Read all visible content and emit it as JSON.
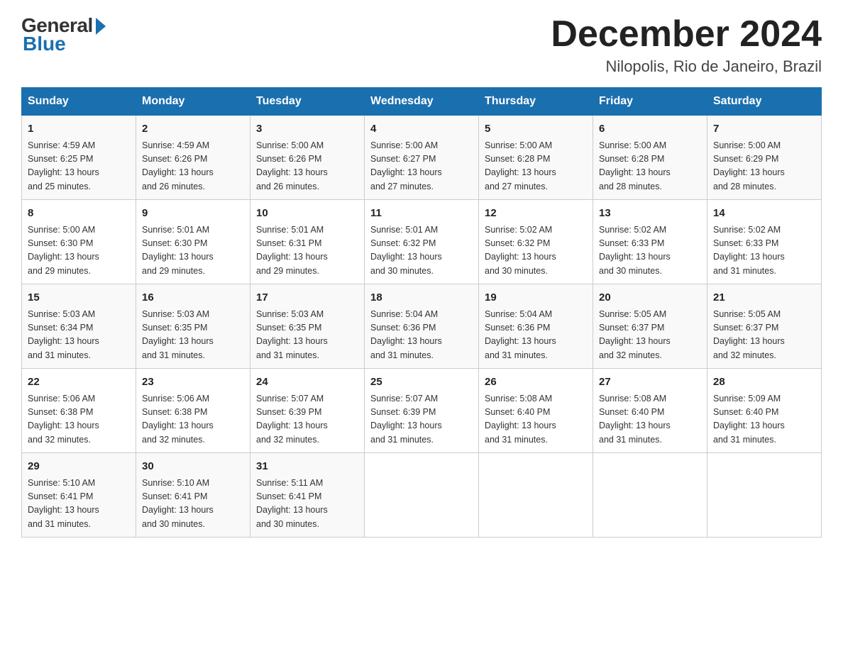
{
  "logo": {
    "general": "General",
    "blue": "Blue"
  },
  "title": "December 2024",
  "location": "Nilopolis, Rio de Janeiro, Brazil",
  "days_of_week": [
    "Sunday",
    "Monday",
    "Tuesday",
    "Wednesday",
    "Thursday",
    "Friday",
    "Saturday"
  ],
  "weeks": [
    [
      {
        "num": "1",
        "sunrise": "4:59 AM",
        "sunset": "6:25 PM",
        "daylight": "13 hours and 25 minutes."
      },
      {
        "num": "2",
        "sunrise": "4:59 AM",
        "sunset": "6:26 PM",
        "daylight": "13 hours and 26 minutes."
      },
      {
        "num": "3",
        "sunrise": "5:00 AM",
        "sunset": "6:26 PM",
        "daylight": "13 hours and 26 minutes."
      },
      {
        "num": "4",
        "sunrise": "5:00 AM",
        "sunset": "6:27 PM",
        "daylight": "13 hours and 27 minutes."
      },
      {
        "num": "5",
        "sunrise": "5:00 AM",
        "sunset": "6:28 PM",
        "daylight": "13 hours and 27 minutes."
      },
      {
        "num": "6",
        "sunrise": "5:00 AM",
        "sunset": "6:28 PM",
        "daylight": "13 hours and 28 minutes."
      },
      {
        "num": "7",
        "sunrise": "5:00 AM",
        "sunset": "6:29 PM",
        "daylight": "13 hours and 28 minutes."
      }
    ],
    [
      {
        "num": "8",
        "sunrise": "5:00 AM",
        "sunset": "6:30 PM",
        "daylight": "13 hours and 29 minutes."
      },
      {
        "num": "9",
        "sunrise": "5:01 AM",
        "sunset": "6:30 PM",
        "daylight": "13 hours and 29 minutes."
      },
      {
        "num": "10",
        "sunrise": "5:01 AM",
        "sunset": "6:31 PM",
        "daylight": "13 hours and 29 minutes."
      },
      {
        "num": "11",
        "sunrise": "5:01 AM",
        "sunset": "6:32 PM",
        "daylight": "13 hours and 30 minutes."
      },
      {
        "num": "12",
        "sunrise": "5:02 AM",
        "sunset": "6:32 PM",
        "daylight": "13 hours and 30 minutes."
      },
      {
        "num": "13",
        "sunrise": "5:02 AM",
        "sunset": "6:33 PM",
        "daylight": "13 hours and 30 minutes."
      },
      {
        "num": "14",
        "sunrise": "5:02 AM",
        "sunset": "6:33 PM",
        "daylight": "13 hours and 31 minutes."
      }
    ],
    [
      {
        "num": "15",
        "sunrise": "5:03 AM",
        "sunset": "6:34 PM",
        "daylight": "13 hours and 31 minutes."
      },
      {
        "num": "16",
        "sunrise": "5:03 AM",
        "sunset": "6:35 PM",
        "daylight": "13 hours and 31 minutes."
      },
      {
        "num": "17",
        "sunrise": "5:03 AM",
        "sunset": "6:35 PM",
        "daylight": "13 hours and 31 minutes."
      },
      {
        "num": "18",
        "sunrise": "5:04 AM",
        "sunset": "6:36 PM",
        "daylight": "13 hours and 31 minutes."
      },
      {
        "num": "19",
        "sunrise": "5:04 AM",
        "sunset": "6:36 PM",
        "daylight": "13 hours and 31 minutes."
      },
      {
        "num": "20",
        "sunrise": "5:05 AM",
        "sunset": "6:37 PM",
        "daylight": "13 hours and 32 minutes."
      },
      {
        "num": "21",
        "sunrise": "5:05 AM",
        "sunset": "6:37 PM",
        "daylight": "13 hours and 32 minutes."
      }
    ],
    [
      {
        "num": "22",
        "sunrise": "5:06 AM",
        "sunset": "6:38 PM",
        "daylight": "13 hours and 32 minutes."
      },
      {
        "num": "23",
        "sunrise": "5:06 AM",
        "sunset": "6:38 PM",
        "daylight": "13 hours and 32 minutes."
      },
      {
        "num": "24",
        "sunrise": "5:07 AM",
        "sunset": "6:39 PM",
        "daylight": "13 hours and 32 minutes."
      },
      {
        "num": "25",
        "sunrise": "5:07 AM",
        "sunset": "6:39 PM",
        "daylight": "13 hours and 31 minutes."
      },
      {
        "num": "26",
        "sunrise": "5:08 AM",
        "sunset": "6:40 PM",
        "daylight": "13 hours and 31 minutes."
      },
      {
        "num": "27",
        "sunrise": "5:08 AM",
        "sunset": "6:40 PM",
        "daylight": "13 hours and 31 minutes."
      },
      {
        "num": "28",
        "sunrise": "5:09 AM",
        "sunset": "6:40 PM",
        "daylight": "13 hours and 31 minutes."
      }
    ],
    [
      {
        "num": "29",
        "sunrise": "5:10 AM",
        "sunset": "6:41 PM",
        "daylight": "13 hours and 31 minutes."
      },
      {
        "num": "30",
        "sunrise": "5:10 AM",
        "sunset": "6:41 PM",
        "daylight": "13 hours and 30 minutes."
      },
      {
        "num": "31",
        "sunrise": "5:11 AM",
        "sunset": "6:41 PM",
        "daylight": "13 hours and 30 minutes."
      },
      null,
      null,
      null,
      null
    ]
  ],
  "labels": {
    "sunrise": "Sunrise:",
    "sunset": "Sunset:",
    "daylight": "Daylight:"
  }
}
